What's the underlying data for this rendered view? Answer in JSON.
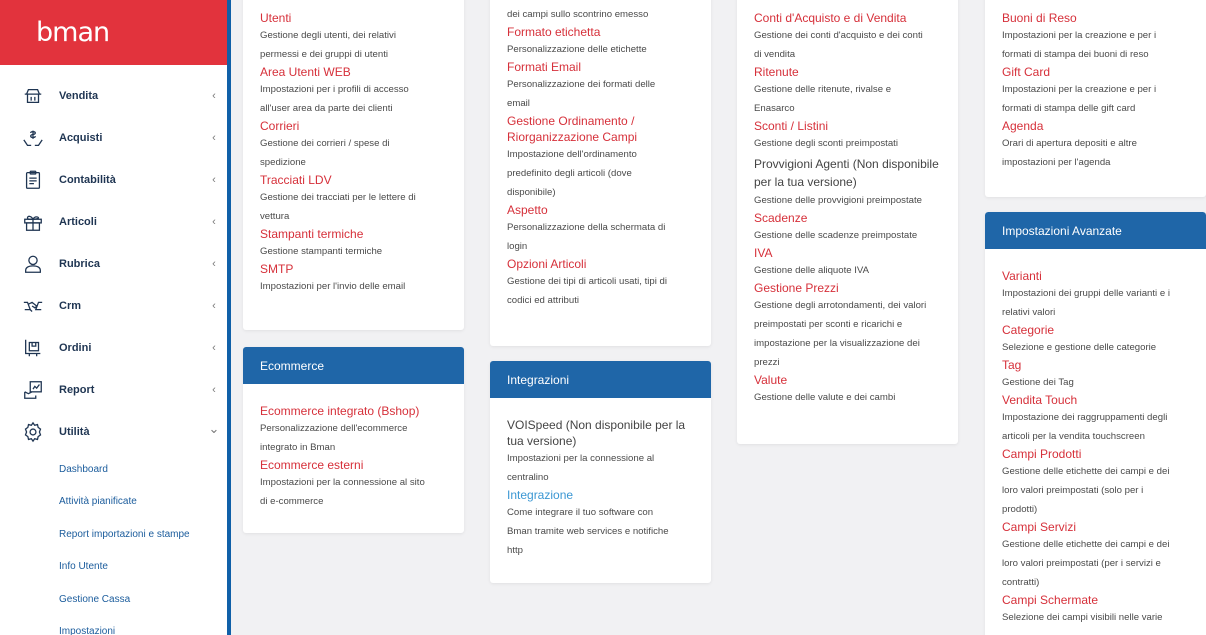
{
  "app": {
    "logo": "bman"
  },
  "nav": {
    "items": [
      {
        "label": "Vendita",
        "icon": "cart-icon"
      },
      {
        "label": "Acquisti",
        "icon": "hand-money-icon"
      },
      {
        "label": "Contabilità",
        "icon": "clipboard-icon"
      },
      {
        "label": "Articoli",
        "icon": "gift-icon"
      },
      {
        "label": "Rubrica",
        "icon": "person-icon"
      },
      {
        "label": "Crm",
        "icon": "handshake-icon"
      },
      {
        "label": "Ordini",
        "icon": "box-icon"
      },
      {
        "label": "Report",
        "icon": "report-icon"
      },
      {
        "label": "Utilità",
        "icon": "gear-icon"
      }
    ],
    "chev_left": "‹",
    "chev_down": "⌄",
    "sub_items": [
      "Dashboard",
      "Attività pianificate",
      "Report importazioni e stampe",
      "Info Utente",
      "Gestione Cassa",
      "Impostazioni"
    ]
  },
  "col1": {
    "entries": [
      {
        "title": "Utenti",
        "desc": [
          "Gestione degli utenti, dei relativi",
          "permessi e dei gruppi di utenti"
        ]
      },
      {
        "title": "Area Utenti WEB",
        "desc": [
          "Impostazioni per i profili di accesso",
          "all'user area da parte dei clienti"
        ]
      },
      {
        "title": "Corrieri",
        "desc": [
          "Gestione dei corrieri / spese di",
          "spedizione"
        ]
      },
      {
        "title": "Tracciati LDV",
        "desc": [
          "Gestione dei tracciati per le lettere di",
          "vettura"
        ]
      },
      {
        "title": "Stampanti termiche",
        "desc": [
          "Gestione stampanti termiche"
        ]
      },
      {
        "title": "SMTP",
        "desc": [
          "Impostazioni per l'invio delle email"
        ]
      }
    ]
  },
  "ecommerce": {
    "header": "Ecommerce",
    "entries": [
      {
        "title": "Ecommerce integrato (Bshop)",
        "desc": [
          "Personalizzazione dell'ecommerce",
          "integrato in Bman"
        ]
      },
      {
        "title": "Ecommerce esterni",
        "desc": [
          "Impostazioni per la connessione al sito",
          "di e-commerce"
        ]
      }
    ]
  },
  "col2": {
    "top_desc": "dei campi sullo scontrino emesso",
    "entries": [
      {
        "title": "Formato etichetta",
        "desc": [
          "Personalizzazione delle etichette"
        ]
      },
      {
        "title": "Formati Email",
        "desc": [
          "Personalizzazione dei formati delle",
          "email"
        ]
      },
      {
        "title": "Gestione Ordinamento / Riorganizzazione Campi",
        "title_lines": [
          "Gestione Ordinamento /",
          "Riorganizzazione Campi"
        ],
        "desc": [
          "Impostazione dell'ordinamento",
          "predefinito degli articoli (dove",
          "disponibile)"
        ]
      },
      {
        "title": "Aspetto",
        "desc": [
          "Personalizzazione della schermata di",
          "login"
        ]
      },
      {
        "title": "Opzioni Articoli",
        "desc": [
          "Gestione dei tipi di articoli usati, tipi di",
          "codici ed attributi"
        ]
      }
    ]
  },
  "integrazioni": {
    "header": "Integrazioni",
    "entries": [
      {
        "title": "VOISpeed (Non disponibile per la tua versione)",
        "title_lines": [
          "VOISpeed (Non disponibile per la",
          "tua versione)"
        ],
        "style": "dark",
        "desc": [
          "Impostazioni per la connessione al",
          "centralino"
        ]
      },
      {
        "title": "Integrazione",
        "style": "blue",
        "desc": [
          "Come integrare il tuo software con",
          "Bman tramite web services e notifiche",
          "http"
        ]
      }
    ]
  },
  "col3": {
    "entries": [
      {
        "title": "Conti d'Acquisto e di Vendita",
        "desc": [
          "Gestione dei conti d'acquisto e dei conti",
          "di vendita"
        ]
      },
      {
        "title": "Ritenute",
        "desc": [
          "Gestione delle ritenute, rivalse e",
          "Enasarco"
        ]
      },
      {
        "title": "Sconti / Listini",
        "desc": [
          "Gestione degli sconti preimpostati"
        ]
      },
      {
        "title": "Provvigioni Agenti (Non disponibile per la tua versione)",
        "title_lines": [
          "Provvigioni Agenti (Non disponibile",
          "per la tua versione)"
        ],
        "style": "dark",
        "desc": [
          "Gestione delle provvigioni preimpostate"
        ]
      },
      {
        "title": "Scadenze",
        "desc": [
          "Gestione delle scadenze preimpostate"
        ]
      },
      {
        "title": "IVA",
        "desc": [
          "Gestione delle aliquote IVA"
        ]
      },
      {
        "title": "Gestione Prezzi",
        "desc": [
          "Gestione degli arrotondamenti, dei valori",
          "preimpostati per sconti e ricarichi e",
          "impostazione per la visualizzazione dei",
          "prezzi"
        ]
      },
      {
        "title": "Valute",
        "desc": [
          "Gestione delle valute e dei cambi"
        ]
      }
    ]
  },
  "col4": {
    "entries": [
      {
        "title": "Buoni di Reso",
        "desc": [
          "Impostazioni per la creazione e per i",
          "formati di stampa dei buoni di reso"
        ]
      },
      {
        "title": "Gift Card",
        "desc": [
          "Impostazioni per la creazione e per i",
          "formati di stampa delle gift card"
        ]
      },
      {
        "title": "Agenda",
        "desc": [
          "Orari di apertura depositi e altre",
          "impostazioni per l'agenda"
        ]
      }
    ]
  },
  "avanzate": {
    "header": "Impostazioni Avanzate",
    "entries": [
      {
        "title": "Varianti",
        "desc": [
          "Impostazioni dei gruppi delle varianti e i",
          "relativi valori"
        ]
      },
      {
        "title": "Categorie",
        "desc": [
          "Selezione e gestione delle categorie"
        ]
      },
      {
        "title": "Tag",
        "desc": [
          "Gestione dei Tag"
        ]
      },
      {
        "title": "Vendita Touch",
        "desc": [
          "Impostazione dei raggruppamenti degli",
          "articoli per la vendita touchscreen"
        ]
      },
      {
        "title": "Campi Prodotti",
        "desc": [
          "Gestione delle etichette dei campi e dei",
          "loro valori preimpostati (solo per i",
          "prodotti)"
        ]
      },
      {
        "title": "Campi Servizi",
        "desc": [
          "Gestione delle etichette dei campi e dei",
          "loro valori preimpostati (per i servizi e",
          "contratti)"
        ]
      },
      {
        "title": "Campi Schermate",
        "desc": [
          "Selezione dei campi visibili nelle varie"
        ]
      }
    ]
  }
}
